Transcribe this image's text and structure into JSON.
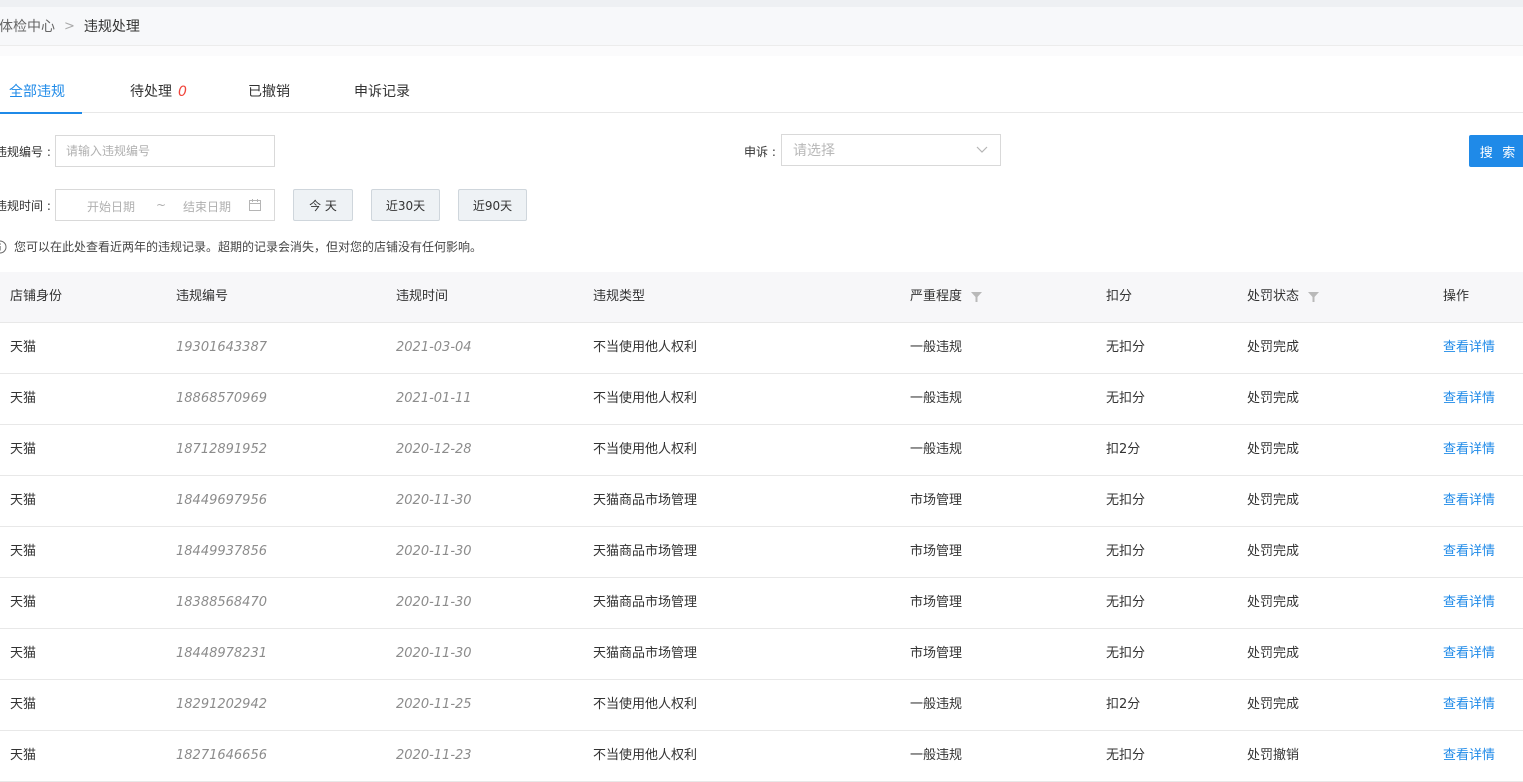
{
  "breadcrumb": {
    "home": "体检中心",
    "separator": ">",
    "current": "违规处理"
  },
  "tabs": [
    {
      "label": "全部违规",
      "active": true
    },
    {
      "label": "待处理",
      "badge": "0"
    },
    {
      "label": "已撤销"
    },
    {
      "label": "申诉记录"
    }
  ],
  "filters": {
    "violation_no_label": "违规编号",
    "violation_no_placeholder": "请输入违规编号",
    "appeal_label": "申诉",
    "appeal_placeholder": "请选择",
    "search_label": "搜 索",
    "time_label": "违规时间",
    "start_placeholder": "开始日期",
    "range_separator": "~",
    "end_placeholder": "结束日期",
    "quick": [
      "今 天",
      "近30天",
      "近90天"
    ]
  },
  "tip": "您可以在此处查看近两年的违规记录。超期的记录会消失，但对您的店铺没有任何影响。",
  "table": {
    "headers": [
      "店铺身份",
      "违规编号",
      "违规时间",
      "违规类型",
      "严重程度",
      "扣分",
      "处罚状态",
      "操作"
    ],
    "rows": [
      [
        "天猫",
        "19301643387",
        "2021-03-04",
        "不当使用他人权利",
        "一般违规",
        "无扣分",
        "处罚完成",
        "查看详情"
      ],
      [
        "天猫",
        "18868570969",
        "2021-01-11",
        "不当使用他人权利",
        "一般违规",
        "无扣分",
        "处罚完成",
        "查看详情"
      ],
      [
        "天猫",
        "18712891952",
        "2020-12-28",
        "不当使用他人权利",
        "一般违规",
        "扣2分",
        "处罚完成",
        "查看详情"
      ],
      [
        "天猫",
        "18449697956",
        "2020-11-30",
        "天猫商品市场管理",
        "市场管理",
        "无扣分",
        "处罚完成",
        "查看详情"
      ],
      [
        "天猫",
        "18449937856",
        "2020-11-30",
        "天猫商品市场管理",
        "市场管理",
        "无扣分",
        "处罚完成",
        "查看详情"
      ],
      [
        "天猫",
        "18388568470",
        "2020-11-30",
        "天猫商品市场管理",
        "市场管理",
        "无扣分",
        "处罚完成",
        "查看详情"
      ],
      [
        "天猫",
        "18448978231",
        "2020-11-30",
        "天猫商品市场管理",
        "市场管理",
        "无扣分",
        "处罚完成",
        "查看详情"
      ],
      [
        "天猫",
        "18291202942",
        "2020-11-25",
        "不当使用他人权利",
        "一般违规",
        "扣2分",
        "处罚完成",
        "查看详情"
      ],
      [
        "天猫",
        "18271646656",
        "2020-11-23",
        "不当使用他人权利",
        "一般违规",
        "无扣分",
        "处罚撤销",
        "查看详情"
      ]
    ]
  },
  "colors": {
    "accent": "#1f8ae8",
    "badge": "#f0453b"
  }
}
